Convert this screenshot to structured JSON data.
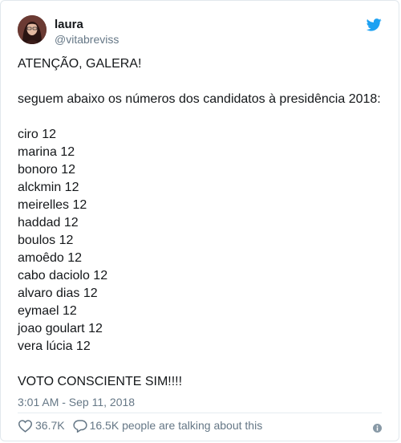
{
  "user": {
    "name": "laura",
    "handle": "@vitabreviss",
    "avatar_icon": "profile-photo"
  },
  "brand": {
    "icon": "twitter-bird-icon",
    "color": "#1da1f2"
  },
  "tweet": {
    "lines": [
      "ATENÇÃO, GALERA!",
      "",
      "seguem abaixo os números dos candidatos à presidência 2018:",
      "",
      "ciro 12",
      "marina 12",
      "bonoro 12",
      "alckmin 12",
      "meirelles 12",
      "haddad 12",
      "boulos 12",
      "amoêdo 12",
      "cabo daciolo 12",
      "alvaro dias 12",
      "eymael 12",
      "joao goulart 12",
      "vera lúcia 12",
      "",
      "VOTO CONSCIENTE SIM!!!!"
    ],
    "timestamp": "3:01 AM - Sep 11, 2018"
  },
  "actions": {
    "likes": "36.7K",
    "like_icon": "heart-icon",
    "talking": "16.5K people are talking about this",
    "reply_icon": "reply-bubble-icon",
    "info_icon": "info-icon"
  }
}
